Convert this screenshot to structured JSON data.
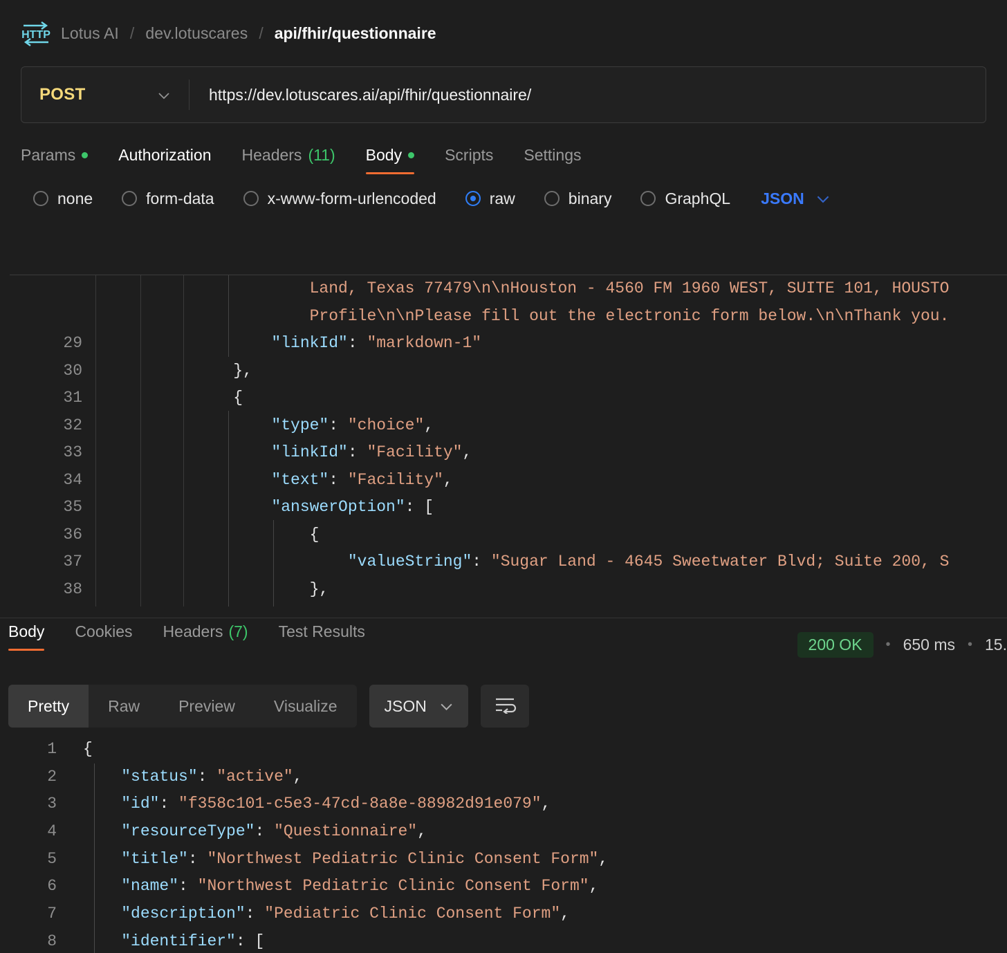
{
  "breadcrumb": {
    "icon": "http-icon",
    "workspace": "Lotus AI",
    "collection": "dev.lotuscares",
    "request": "api/fhir/questionnaire",
    "separator": "/"
  },
  "url_bar": {
    "method": "POST",
    "method_chevron_icon": "chevron-down-icon",
    "url": "https://dev.lotuscares.ai/api/fhir/questionnaire/"
  },
  "request_tabs": [
    {
      "label": "Params",
      "dot": true,
      "active": false,
      "bright": false
    },
    {
      "label": "Authorization",
      "dot": false,
      "active": false,
      "bright": true
    },
    {
      "label": "Headers",
      "count": "(11)",
      "dot": false,
      "active": false,
      "bright": false
    },
    {
      "label": "Body",
      "dot": true,
      "active": true,
      "bright": true
    },
    {
      "label": "Scripts",
      "dot": false,
      "active": false,
      "bright": false
    },
    {
      "label": "Settings",
      "dot": false,
      "active": false,
      "bright": false
    }
  ],
  "body_types": [
    {
      "label": "none",
      "selected": false
    },
    {
      "label": "form-data",
      "selected": false
    },
    {
      "label": "x-www-form-urlencoded",
      "selected": false
    },
    {
      "label": "raw",
      "selected": true
    },
    {
      "label": "binary",
      "selected": false
    },
    {
      "label": "GraphQL",
      "selected": false
    }
  ],
  "body_language": {
    "label": "JSON",
    "chevron_icon": "chevron-down-icon"
  },
  "request_body_lines": [
    {
      "num": "",
      "segments": [
        {
          "t": "            Land, Texas 77479\\n\\nHouston - 4560 FM 1960 WEST, SUITE 101, HOUSTO",
          "c": "s"
        }
      ]
    },
    {
      "num": "",
      "segments": [
        {
          "t": "            Profile\\n\\nPlease fill out the electronic form below.\\n\\nThank you.",
          "c": "s"
        }
      ]
    },
    {
      "num": "29",
      "segments": [
        {
          "t": "        ",
          "c": "p"
        },
        {
          "t": "\"linkId\"",
          "c": "k"
        },
        {
          "t": ": ",
          "c": "p"
        },
        {
          "t": "\"markdown-1\"",
          "c": "s"
        }
      ]
    },
    {
      "num": "30",
      "segments": [
        {
          "t": "    },",
          "c": "p"
        }
      ]
    },
    {
      "num": "31",
      "segments": [
        {
          "t": "    {",
          "c": "p"
        }
      ]
    },
    {
      "num": "32",
      "segments": [
        {
          "t": "        ",
          "c": "p"
        },
        {
          "t": "\"type\"",
          "c": "k"
        },
        {
          "t": ": ",
          "c": "p"
        },
        {
          "t": "\"choice\"",
          "c": "s"
        },
        {
          "t": ",",
          "c": "p"
        }
      ]
    },
    {
      "num": "33",
      "segments": [
        {
          "t": "        ",
          "c": "p"
        },
        {
          "t": "\"linkId\"",
          "c": "k"
        },
        {
          "t": ": ",
          "c": "p"
        },
        {
          "t": "\"Facility\"",
          "c": "s"
        },
        {
          "t": ",",
          "c": "p"
        }
      ]
    },
    {
      "num": "34",
      "segments": [
        {
          "t": "        ",
          "c": "p"
        },
        {
          "t": "\"text\"",
          "c": "k"
        },
        {
          "t": ": ",
          "c": "p"
        },
        {
          "t": "\"Facility\"",
          "c": "s"
        },
        {
          "t": ",",
          "c": "p"
        }
      ]
    },
    {
      "num": "35",
      "segments": [
        {
          "t": "        ",
          "c": "p"
        },
        {
          "t": "\"answerOption\"",
          "c": "k"
        },
        {
          "t": ": [",
          "c": "p"
        }
      ]
    },
    {
      "num": "36",
      "segments": [
        {
          "t": "            {",
          "c": "p"
        }
      ]
    },
    {
      "num": "37",
      "segments": [
        {
          "t": "                ",
          "c": "p"
        },
        {
          "t": "\"valueString\"",
          "c": "k"
        },
        {
          "t": ": ",
          "c": "p"
        },
        {
          "t": "\"Sugar Land - 4645 Sweetwater Blvd; Suite 200, S",
          "c": "s"
        }
      ]
    },
    {
      "num": "38",
      "segments": [
        {
          "t": "            },",
          "c": "p"
        }
      ]
    }
  ],
  "response_tabs": [
    {
      "label": "Body",
      "active": true
    },
    {
      "label": "Cookies",
      "active": false
    },
    {
      "label": "Headers",
      "count": "(7)",
      "active": false
    },
    {
      "label": "Test Results",
      "active": false
    }
  ],
  "response_meta": {
    "status": "200 OK",
    "time": "650 ms",
    "size": "15.",
    "bullet": "•"
  },
  "response_toolbar": {
    "views": [
      {
        "label": "Pretty",
        "active": true
      },
      {
        "label": "Raw",
        "active": false
      },
      {
        "label": "Preview",
        "active": false
      },
      {
        "label": "Visualize",
        "active": false
      }
    ],
    "language": {
      "label": "JSON",
      "chevron_icon": "chevron-down-icon"
    },
    "wrap_button_icon": "word-wrap-icon"
  },
  "response_body_lines": [
    {
      "num": "1",
      "segments": [
        {
          "t": "{",
          "c": "p"
        }
      ]
    },
    {
      "num": "2",
      "segments": [
        {
          "t": "    ",
          "c": "p"
        },
        {
          "t": "\"status\"",
          "c": "k"
        },
        {
          "t": ": ",
          "c": "p"
        },
        {
          "t": "\"active\"",
          "c": "s"
        },
        {
          "t": ",",
          "c": "p"
        }
      ]
    },
    {
      "num": "3",
      "segments": [
        {
          "t": "    ",
          "c": "p"
        },
        {
          "t": "\"id\"",
          "c": "k"
        },
        {
          "t": ": ",
          "c": "p"
        },
        {
          "t": "\"f358c101-c5e3-47cd-8a8e-88982d91e079\"",
          "c": "s"
        },
        {
          "t": ",",
          "c": "p"
        }
      ]
    },
    {
      "num": "4",
      "segments": [
        {
          "t": "    ",
          "c": "p"
        },
        {
          "t": "\"resourceType\"",
          "c": "k"
        },
        {
          "t": ": ",
          "c": "p"
        },
        {
          "t": "\"Questionnaire\"",
          "c": "s"
        },
        {
          "t": ",",
          "c": "p"
        }
      ]
    },
    {
      "num": "5",
      "segments": [
        {
          "t": "    ",
          "c": "p"
        },
        {
          "t": "\"title\"",
          "c": "k"
        },
        {
          "t": ": ",
          "c": "p"
        },
        {
          "t": "\"Northwest Pediatric Clinic Consent Form\"",
          "c": "s"
        },
        {
          "t": ",",
          "c": "p"
        }
      ]
    },
    {
      "num": "6",
      "segments": [
        {
          "t": "    ",
          "c": "p"
        },
        {
          "t": "\"name\"",
          "c": "k"
        },
        {
          "t": ": ",
          "c": "p"
        },
        {
          "t": "\"Northwest Pediatric Clinic Consent Form\"",
          "c": "s"
        },
        {
          "t": ",",
          "c": "p"
        }
      ]
    },
    {
      "num": "7",
      "segments": [
        {
          "t": "    ",
          "c": "p"
        },
        {
          "t": "\"description\"",
          "c": "k"
        },
        {
          "t": ": ",
          "c": "p"
        },
        {
          "t": "\"Pediatric Clinic Consent Form\"",
          "c": "s"
        },
        {
          "t": ",",
          "c": "p"
        }
      ]
    },
    {
      "num": "8",
      "segments": [
        {
          "t": "    ",
          "c": "p"
        },
        {
          "t": "\"identifier\"",
          "c": "k"
        },
        {
          "t": ": [",
          "c": "p"
        }
      ]
    }
  ],
  "colors": {
    "background": "#1e1e1e",
    "accent_orange": "#ef6c32",
    "accent_blue": "#3a7afe",
    "method_yellow": "#f5d97b",
    "green": "#3dc66a",
    "json_key": "#9cdcfe",
    "json_string": "#e0a083",
    "icon_cyan": "#6fd6e8"
  }
}
